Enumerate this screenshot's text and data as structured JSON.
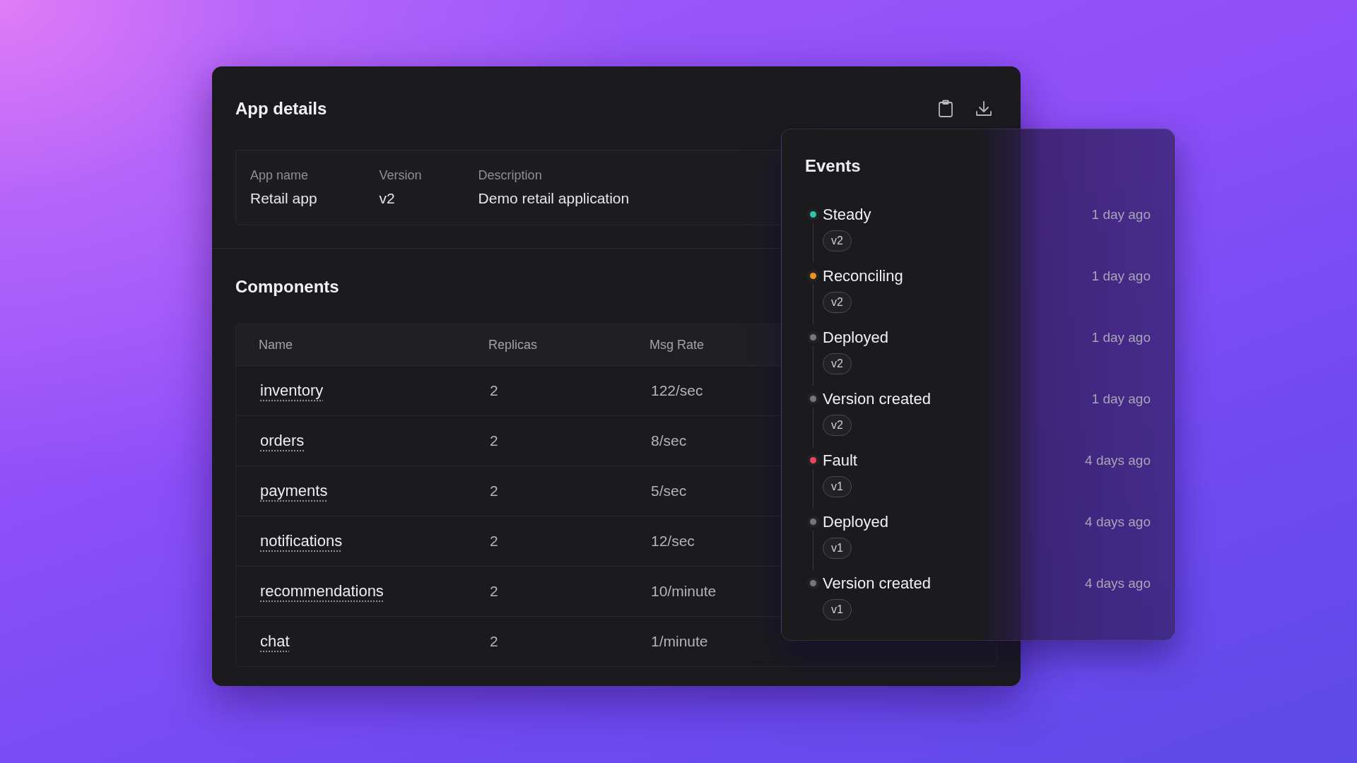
{
  "app_details": {
    "title": "App details",
    "fields": [
      {
        "label": "App name",
        "value": "Retail app"
      },
      {
        "label": "Version",
        "value": "v2"
      },
      {
        "label": "Description",
        "value": "Demo retail application"
      }
    ]
  },
  "components": {
    "title": "Components",
    "columns": [
      "Name",
      "Replicas",
      "Msg Rate"
    ],
    "rows": [
      {
        "name": "inventory",
        "replicas": "2",
        "rate": "122/sec"
      },
      {
        "name": "orders",
        "replicas": "2",
        "rate": "8/sec"
      },
      {
        "name": "payments",
        "replicas": "2",
        "rate": "5/sec"
      },
      {
        "name": "notifications",
        "replicas": "2",
        "rate": "12/sec"
      },
      {
        "name": "recommendations",
        "replicas": "2",
        "rate": "10/minute"
      },
      {
        "name": "chat",
        "replicas": "2",
        "rate": "1/minute"
      }
    ]
  },
  "events": {
    "title": "Events",
    "items": [
      {
        "label": "Steady",
        "version": "v2",
        "time": "1 day ago",
        "color": "#2ec4b0"
      },
      {
        "label": "Reconciling",
        "version": "v2",
        "time": "1 day ago",
        "color": "#e8961e"
      },
      {
        "label": "Deployed",
        "version": "v2",
        "time": "1 day ago",
        "color": "#77767e"
      },
      {
        "label": "Version created",
        "version": "v2",
        "time": "1 day ago",
        "color": "#77767e"
      },
      {
        "label": "Fault",
        "version": "v1",
        "time": "4 days ago",
        "color": "#f0435f"
      },
      {
        "label": "Deployed",
        "version": "v1",
        "time": "4 days ago",
        "color": "#77767e"
      },
      {
        "label": "Version created",
        "version": "v1",
        "time": "4 days ago",
        "color": "#77767e"
      }
    ]
  }
}
